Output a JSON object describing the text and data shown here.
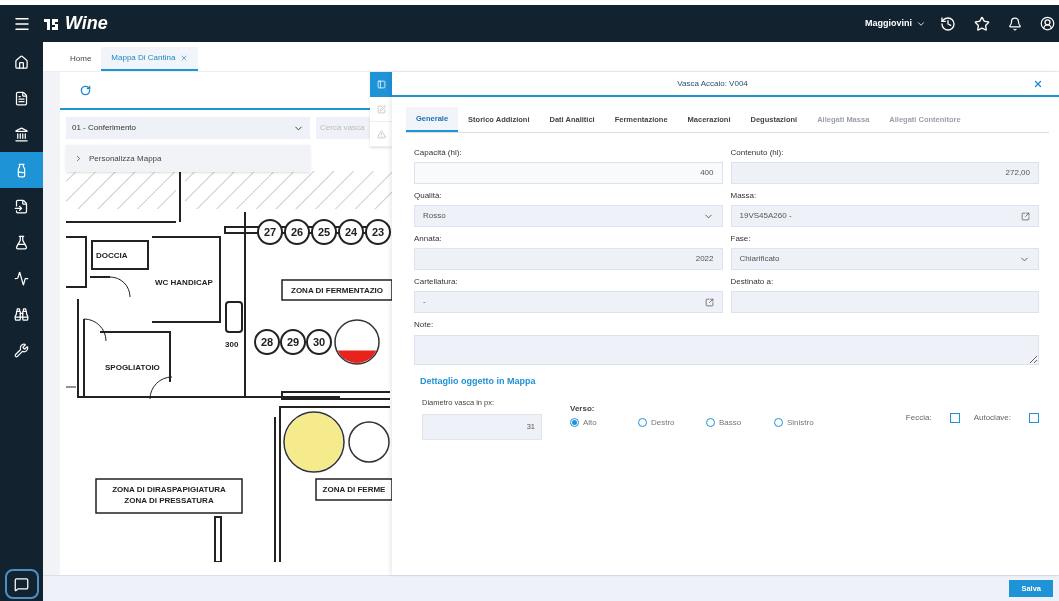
{
  "brand": {
    "name": "Wine"
  },
  "header": {
    "user": "Maggiovini"
  },
  "sidebar": {
    "items": [
      {
        "kind": "home",
        "selected": false
      },
      {
        "kind": "document",
        "selected": false
      },
      {
        "kind": "bank",
        "selected": false
      },
      {
        "kind": "bottle",
        "selected": true
      },
      {
        "kind": "import",
        "selected": false
      },
      {
        "kind": "flask",
        "selected": false
      },
      {
        "kind": "pulse",
        "selected": false
      },
      {
        "kind": "binoculars",
        "selected": false
      },
      {
        "kind": "tools",
        "selected": false
      }
    ]
  },
  "page_tabs": [
    {
      "label": "Home",
      "selected": false,
      "closable": false
    },
    {
      "label": "Mappa Di Cantina",
      "selected": true,
      "closable": true
    }
  ],
  "map_panel": {
    "zone_select": {
      "value": "01 - Conferimento"
    },
    "search": {
      "placeholder": "Cerca vasca"
    },
    "accordion": {
      "label": "Personalizza Mappa",
      "expanded": false
    },
    "plan": {
      "rooms": [
        {
          "label": "DOCCIA"
        },
        {
          "label": "WC HANDICAP"
        },
        {
          "label": "SPOGLIATOIO"
        },
        {
          "label": "300"
        }
      ],
      "zones": [
        {
          "lines": [
            "ZONA DI FERMENTAZIO"
          ]
        },
        {
          "lines": [
            "ZONA DI DIRASPAPIGIATURA",
            "ZONA DI PRESSATURA"
          ]
        },
        {
          "lines": [
            "ZONA DI FERME"
          ]
        }
      ],
      "tanks": [
        {
          "number": "27"
        },
        {
          "number": "26"
        },
        {
          "number": "25"
        },
        {
          "number": "24"
        },
        {
          "number": "23"
        },
        {
          "number": "28"
        },
        {
          "number": "29"
        },
        {
          "number": "30"
        }
      ],
      "filled_tanks": [
        {
          "kind": "partial",
          "color": "#e8231c"
        },
        {
          "kind": "full",
          "color": "#f5ea8c"
        }
      ]
    }
  },
  "side_tools": [
    {
      "kind": "panel",
      "selected": true
    },
    {
      "kind": "edit",
      "selected": false
    },
    {
      "kind": "warning",
      "selected": false
    }
  ],
  "detail": {
    "title": "Vasca Accaio: V004",
    "tabs": [
      {
        "label": "Generale",
        "selected": true,
        "disabled": false
      },
      {
        "label": "Storico Addizioni",
        "selected": false,
        "disabled": false
      },
      {
        "label": "Dati Analitici",
        "selected": false,
        "disabled": false
      },
      {
        "label": "Fermentazione",
        "selected": false,
        "disabled": false
      },
      {
        "label": "Macerazioni",
        "selected": false,
        "disabled": false
      },
      {
        "label": "Degustazioni",
        "selected": false,
        "disabled": false
      },
      {
        "label": "Allegati Massa",
        "selected": false,
        "disabled": true
      },
      {
        "label": "Allegati Contenitore",
        "selected": false,
        "disabled": true
      }
    ],
    "fields": [
      {
        "label": "Capacità (hl):",
        "value": "400",
        "kind": "number"
      },
      {
        "label": "Contenuto (hl):",
        "value": "272,00",
        "kind": "number"
      },
      {
        "label": "Qualità:",
        "value": "Rosso",
        "kind": "select"
      },
      {
        "label": "Massa:",
        "value": "19VS45A260 -",
        "kind": "lookup"
      },
      {
        "label": "Annata:",
        "value": "2022",
        "kind": "number"
      },
      {
        "label": "Fase:",
        "value": "Chiarificato",
        "kind": "select"
      },
      {
        "label": "Cartellatura:",
        "value": "-",
        "kind": "lookup"
      },
      {
        "label": "Destinato a:",
        "kind": "text"
      }
    ],
    "notes": {
      "label": "Note:"
    },
    "map_detail": {
      "title": "Dettaglio oggetto in Mappa",
      "diameter": {
        "label": "Diametro vasca in px:",
        "value": "31"
      },
      "direction": {
        "label": "Verso:",
        "options": [
          {
            "label": "Alto",
            "selected": true
          },
          {
            "label": "Destro",
            "selected": false
          },
          {
            "label": "Basso",
            "selected": false
          },
          {
            "label": "Sinistro",
            "selected": false
          }
        ]
      },
      "checks": [
        {
          "label": "Feccia:",
          "checked": false
        },
        {
          "label": "Autoclave:",
          "checked": false
        }
      ]
    }
  },
  "footer": {
    "save": "Salva"
  }
}
